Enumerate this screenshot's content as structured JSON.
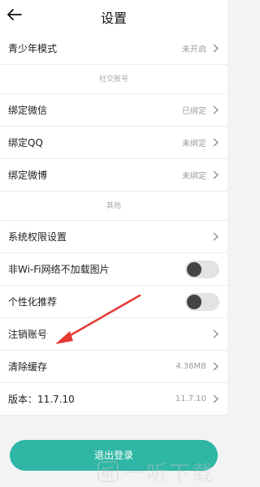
{
  "header": {
    "title": "设置"
  },
  "rows": [
    {
      "label": "青少年模式",
      "value": "未开启"
    },
    {
      "section": "社交账号"
    },
    {
      "label": "绑定微信",
      "value": "已绑定"
    },
    {
      "label": "绑定QQ",
      "value": "未绑定"
    },
    {
      "label": "绑定微博",
      "value": "未绑定"
    },
    {
      "section": "其他"
    },
    {
      "label": "系统权限设置",
      "value": ""
    },
    {
      "label": "非Wi-Fi网络不加载图片",
      "toggle": false
    },
    {
      "label": "个性化推荐",
      "toggle": false
    },
    {
      "label": "注销账号",
      "value": ""
    },
    {
      "label": "清除缓存",
      "value": "4.36MB"
    },
    {
      "label": "版本：11.7.10",
      "value": "11.7.10"
    }
  ],
  "footer": {
    "logout_label": "退出登录"
  },
  "watermark": {
    "text": "一听下载"
  },
  "colors": {
    "accent": "#2fb6a4",
    "annotation_arrow": "#e53935"
  }
}
